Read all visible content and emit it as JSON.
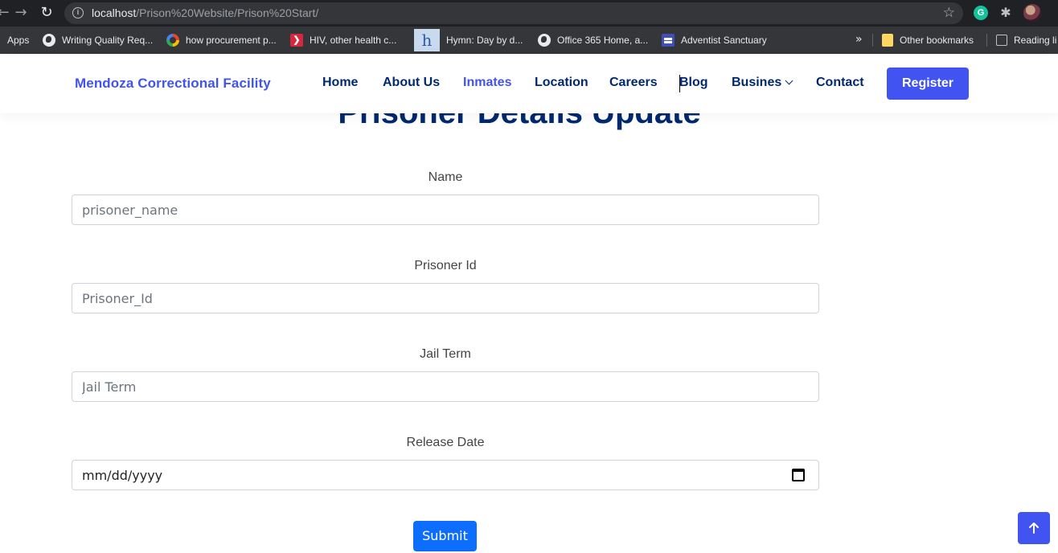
{
  "browser": {
    "url_host": "localhost",
    "url_path": "/Prison%20Website/Prison%20Start/",
    "bookmarks": [
      {
        "label": "Apps",
        "icon": "apps-grid-icon"
      },
      {
        "label": "Writing Quality Req...",
        "icon": "globe-icon"
      },
      {
        "label": "how procurement p...",
        "icon": "google-icon"
      },
      {
        "label": "HIV, other health c...",
        "icon": "red-bookmark-icon"
      },
      {
        "label": "Hymn: Day by d...",
        "icon": "hymn-icon"
      },
      {
        "label": "Office 365 Home, a...",
        "icon": "globe-icon"
      },
      {
        "label": "Adventist Sanctuary",
        "icon": "adventist-icon"
      }
    ],
    "more_label": "»",
    "other_bookmarks": "Other bookmarks",
    "reading_list": "Reading li",
    "hymn_glyph": "h",
    "red_glyph": "❯",
    "grammarly_glyph": "G"
  },
  "header": {
    "brand": "Mendoza Correctional Facility",
    "nav": {
      "home": "Home",
      "about": "About Us",
      "inmates": "Inmates",
      "location": "Location",
      "careers": "Careers",
      "blog": "Blog",
      "business": "Busines",
      "contact": "Contact"
    },
    "active_item": "Inmates",
    "register": "Register"
  },
  "form": {
    "title": "Prisoner Details Update",
    "fields": {
      "name": {
        "label": "Name",
        "placeholder": "prisoner_name"
      },
      "prisoner_id": {
        "label": "Prisoner Id",
        "placeholder": "Prisoner_Id"
      },
      "jail_term": {
        "label": "Jail Term",
        "placeholder": "Jail Term"
      },
      "release_date": {
        "label": "Release Date",
        "value": "mm/dd/yyyy"
      }
    },
    "submit": "Submit"
  },
  "colors": {
    "brand_blue": "#4154f1",
    "nav_dark": "#012970",
    "submit_blue": "#0d6efd"
  }
}
